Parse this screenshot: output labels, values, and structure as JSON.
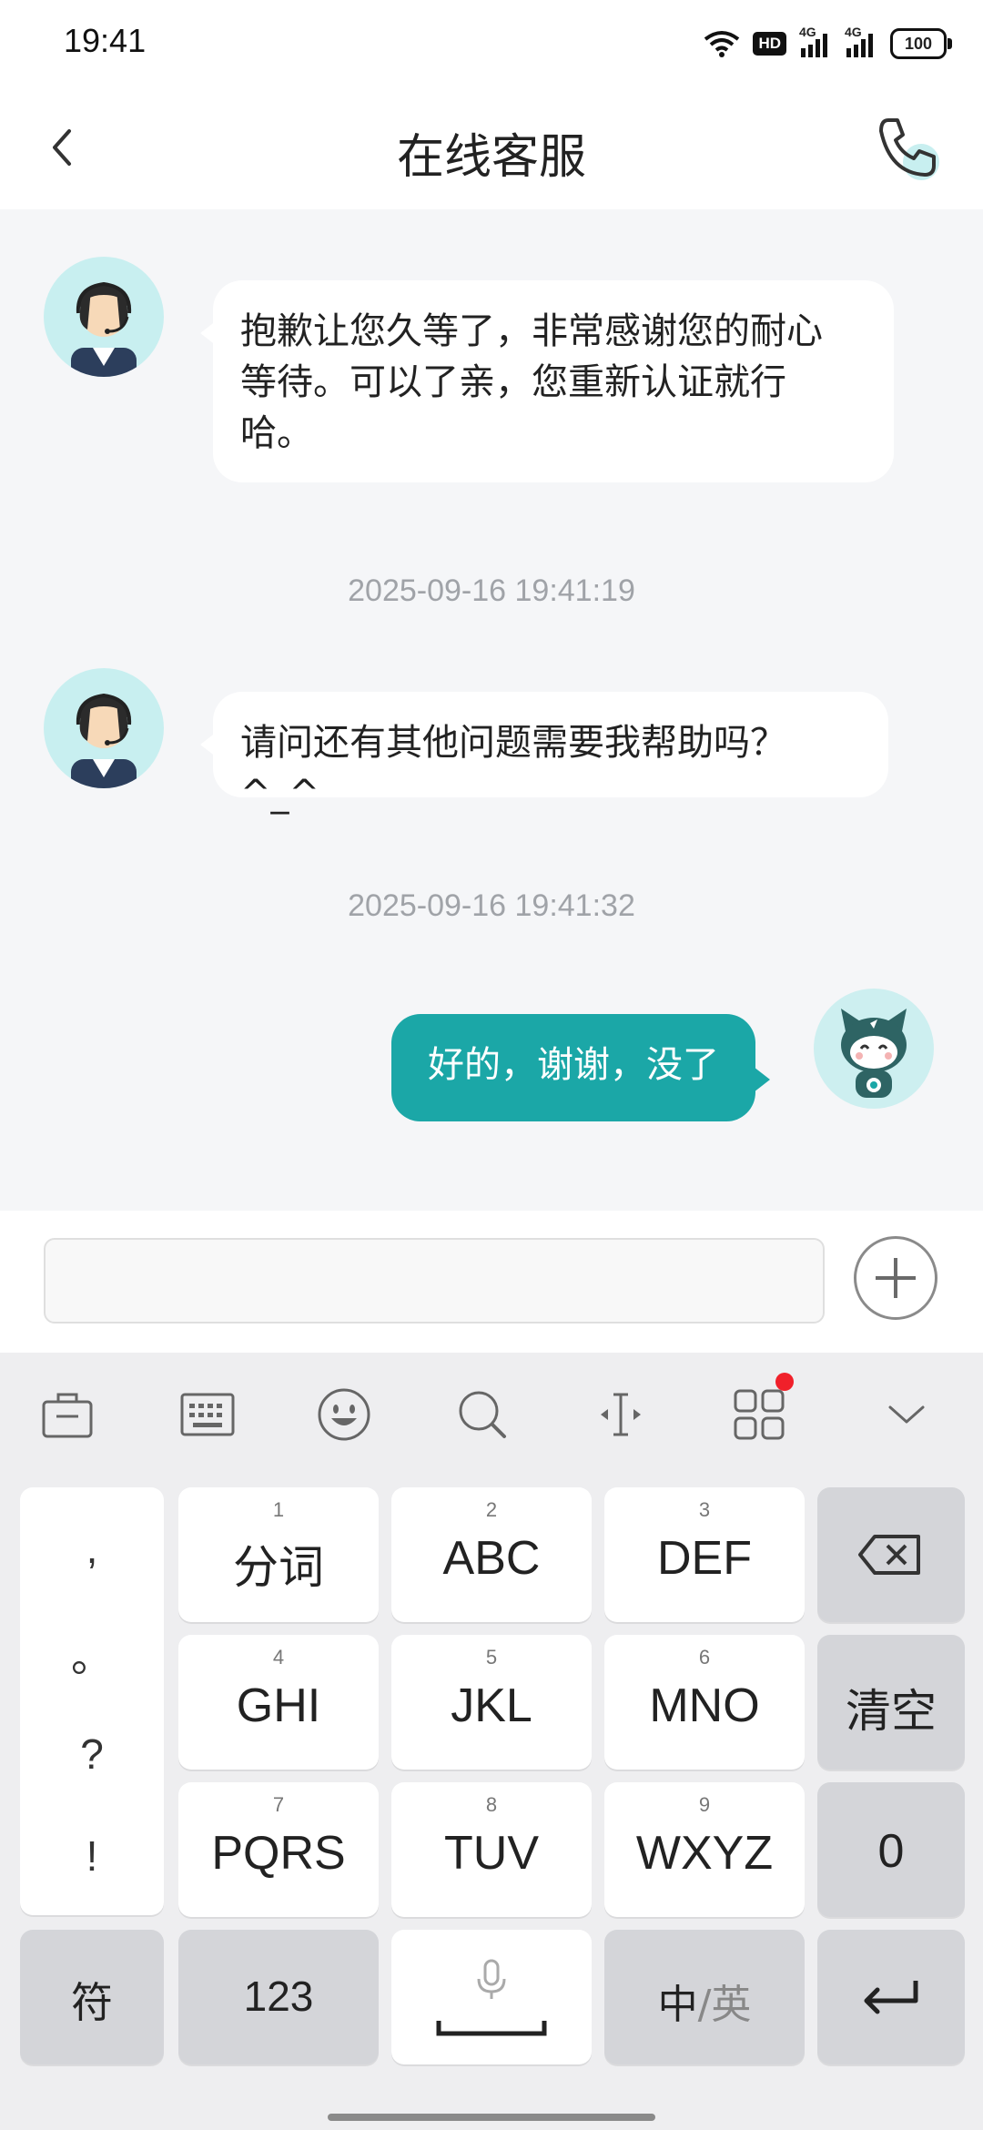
{
  "status_bar": {
    "time": "19:41",
    "battery": "100",
    "network_1": "4G",
    "network_2": "4G",
    "hd_badge": "HD"
  },
  "header": {
    "title": "在线客服"
  },
  "messages": [
    {
      "sender": "agent",
      "text_line1": "抱歉让您久等了，非常感谢您的耐心",
      "text_line2": "等待。可以了亲，您重新认证就行",
      "text_line3": "哈。"
    },
    {
      "timestamp": "2025-09-16 19:41:19"
    },
    {
      "sender": "agent",
      "text": "请问还有其他问题需要我帮助吗？^_^"
    },
    {
      "timestamp": "2025-09-16 19:41:32"
    },
    {
      "sender": "user",
      "text": "好的，谢谢，没了"
    }
  ],
  "input": {
    "placeholder": ""
  },
  "keyboard": {
    "punct": [
      ",",
      "。",
      "?",
      "!"
    ],
    "keys": [
      {
        "num": "1",
        "label": "分词"
      },
      {
        "num": "2",
        "label": "ABC"
      },
      {
        "num": "3",
        "label": "DEF"
      },
      {
        "num": "4",
        "label": "GHI"
      },
      {
        "num": "5",
        "label": "JKL"
      },
      {
        "num": "6",
        "label": "MNO"
      },
      {
        "num": "7",
        "label": "PQRS"
      },
      {
        "num": "8",
        "label": "TUV"
      },
      {
        "num": "9",
        "label": "WXYZ"
      }
    ],
    "clear_label": "清空",
    "zero_label": "0",
    "symbol_label": "符",
    "num_label": "123",
    "lang_label_cn": "中",
    "lang_label_en": "/英"
  },
  "colors": {
    "accent": "#1ba7a7",
    "notification_dot": "#f0202a"
  }
}
